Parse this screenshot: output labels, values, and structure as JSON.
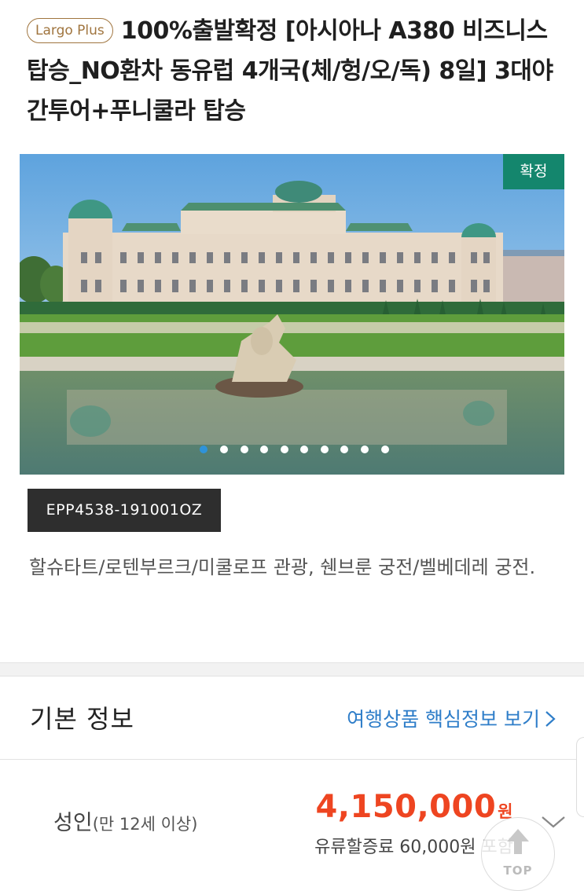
{
  "product": {
    "brand_badge": "Largo Plus",
    "title": "100%출발확정 [아시아나 A380 비즈니스 탑승_NO환차 동유럽 4개국(체/헝/오/독) 8일] 3대야간투어+푸니쿨라 탑승",
    "status_badge": "확정",
    "code": "EPP4538-191001OZ",
    "summary": "할슈타트/로텐부르크/미쿨로프 관광, 쉔브룬 궁전/벨베데레 궁전."
  },
  "carousel": {
    "slide_count": 10,
    "active_index": 0
  },
  "basic_info": {
    "section_title": "기본 정보",
    "core_info_link": "여행상품 핵심정보 보기",
    "price_row": {
      "label": "성인",
      "condition": "(만 12세 이상)",
      "price": "4,150,000",
      "currency_unit": "원",
      "fuel_surcharge_note": "유류할증료 60,000원 포함"
    }
  },
  "top_button": {
    "label": "TOP"
  },
  "colors": {
    "brand": "#a0753f",
    "confirm_badge": "#14866d",
    "price": "#ee4521",
    "link": "#2f7ec9",
    "active_dot": "#2f93d9"
  },
  "icons": {
    "core_link": "chevron-right-icon",
    "expand": "chevron-down-icon",
    "top": "arrow-up-icon"
  }
}
